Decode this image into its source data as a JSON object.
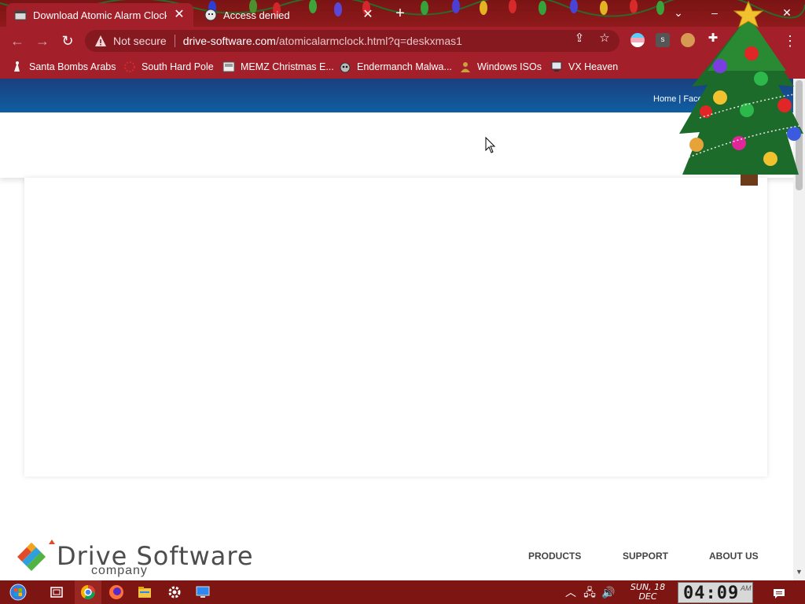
{
  "browser": {
    "tabs": [
      {
        "title": "Download Atomic Alarm Clock -",
        "active": true
      },
      {
        "title": "Access denied",
        "active": false
      }
    ],
    "address": {
      "security_label": "Not secure",
      "url_host": "drive-software.com",
      "url_path": "/atomicalarmclock.html?q=deskxmas1"
    },
    "bookmarks": [
      {
        "label": "Santa Bombs Arabs"
      },
      {
        "label": "South Hard Pole"
      },
      {
        "label": "MEMZ Christmas E..."
      },
      {
        "label": "Endermanch Malwa..."
      },
      {
        "label": "Windows ISOs"
      },
      {
        "label": "VX Heaven"
      }
    ],
    "theme_colors": {
      "frame": "#7a1414",
      "toolbar": "#a3202a"
    }
  },
  "page": {
    "top_links": {
      "home": "Home",
      "divider": " | ",
      "facebook": "Faceb"
    },
    "brand": {
      "name": "Drive Software",
      "sub": "company"
    },
    "footer_nav": [
      "PRODUCTS",
      "SUPPORT",
      "ABOUT US"
    ],
    "colors": {
      "top_bar": "#1b3f7e"
    }
  },
  "taskbar": {
    "date_line1": "SUN, 18",
    "date_line2": "DEC",
    "clock": "04:09",
    "ampm": "AM"
  }
}
